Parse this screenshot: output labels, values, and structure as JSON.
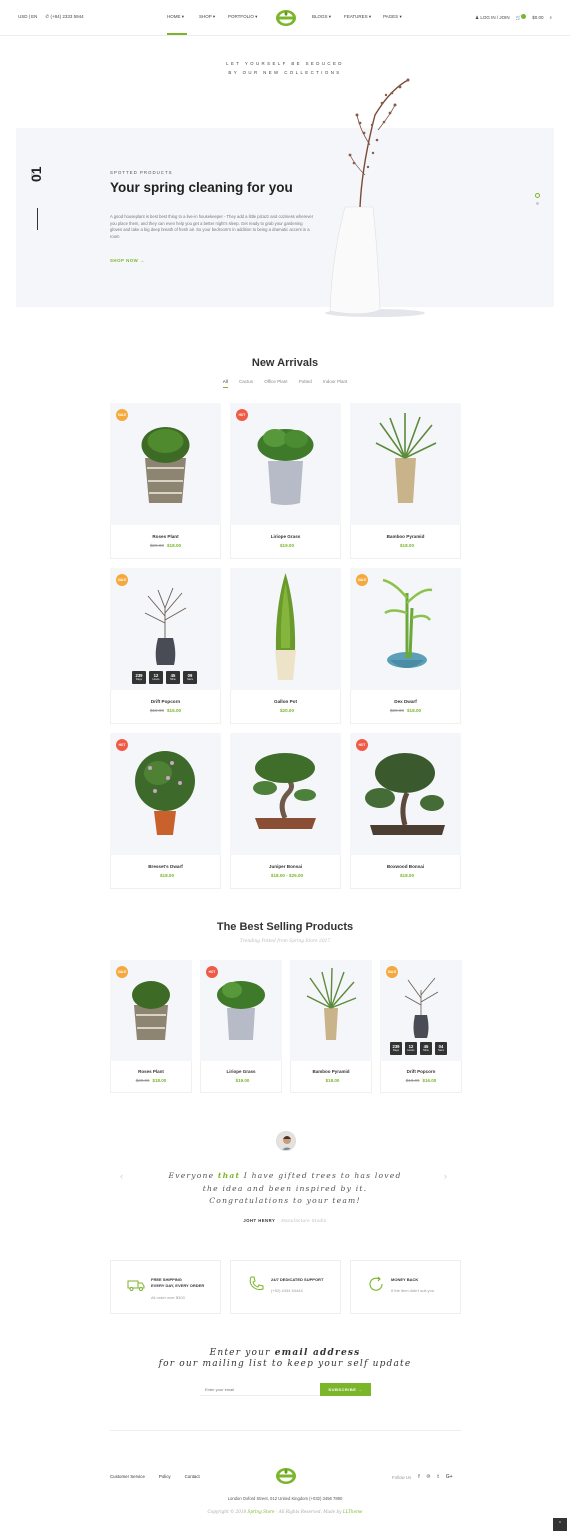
{
  "header": {
    "currency": "USD | EN",
    "phone": "(+84) 2333 5944",
    "nav": [
      "HOME",
      "SHOP",
      "PORTFOLIO",
      "BLOGS",
      "FEATURES",
      "PAGES"
    ],
    "login": "LOG IN / JOIN",
    "cart_total": "$0.00"
  },
  "hero": {
    "kicker_line1": "LET YOURSELF BE SEDUCED",
    "kicker_line2": "BY OUR NEW COLLECTIONS",
    "slide_number": "01",
    "slide_total": "/02",
    "tag": "SPOTTED PRODUCTS",
    "title": "Your spring cleaning for you",
    "description": "A good houseplant is best best thing to a live-in housekeeper - They add a little pizazz and coziness wherever you place them, and they can even help you get a better night's sleep. Get ready to grab your gardening gloves and take a big deep breath of fresh air. So your bedroom's in addition to being a dramatic accent in a room",
    "link": "SHOP NOW →"
  },
  "new_arrivals": {
    "title": "New Arrivals",
    "filters": [
      "All",
      "Cactus",
      "Office Plant",
      "Potted",
      "Indoor Plant"
    ],
    "products": [
      {
        "name": "Roses Plant",
        "old_price": "$20.00",
        "price": "$18.00",
        "badge": "SALE"
      },
      {
        "name": "Liriope Grass",
        "old_price": "",
        "price": "$19.00",
        "badge": "HOT"
      },
      {
        "name": "Bamboo Pyramid",
        "old_price": "",
        "price": "$18.00",
        "badge": ""
      },
      {
        "name": "Drift Popcorn",
        "old_price": "$18.00",
        "price": "$16.00",
        "badge": "SALE"
      },
      {
        "name": "Gallon Pot",
        "old_price": "",
        "price": "$20.00",
        "badge": ""
      },
      {
        "name": "Dex Dwarf",
        "old_price": "$20.00",
        "price": "$18.00",
        "badge": "SALE"
      },
      {
        "name": "Bresset's Dwarf",
        "old_price": "",
        "price": "$18.00",
        "badge": "HOT"
      },
      {
        "name": "Juniper Bonsai",
        "old_price": "",
        "price": "$18.00 - $25.00",
        "badge": ""
      },
      {
        "name": "Boxwood Bonsai",
        "old_price": "",
        "price": "$18.00",
        "badge": "HOT"
      }
    ],
    "countdown": [
      {
        "value": "239",
        "unit": "Days"
      },
      {
        "value": "12",
        "unit": "Hours"
      },
      {
        "value": "45",
        "unit": "Mins"
      },
      {
        "value": "09",
        "unit": "Secs"
      }
    ]
  },
  "best_selling": {
    "title": "The Best Selling Products",
    "subtitle": "Trending Potted from Spring Store 2017",
    "products": [
      {
        "name": "Roses Plant",
        "old_price": "$20.00",
        "price": "$18.00",
        "badge": "SALE"
      },
      {
        "name": "Liriope Grass",
        "old_price": "",
        "price": "$19.00",
        "badge": "HOT"
      },
      {
        "name": "Bamboo Pyramid",
        "old_price": "",
        "price": "$18.00",
        "badge": ""
      },
      {
        "name": "Drift Popcorn",
        "old_price": "$18.00",
        "price": "$16.00",
        "badge": "SALE"
      }
    ],
    "countdown": [
      {
        "value": "239",
        "unit": "Days"
      },
      {
        "value": "12",
        "unit": "Hours"
      },
      {
        "value": "45",
        "unit": "Mins"
      },
      {
        "value": "04",
        "unit": "Secs"
      }
    ]
  },
  "testimonial": {
    "quote_before": "Everyone ",
    "quote_highlight": "that",
    "quote_after": " I have gifted trees to has loved the idea and been inspired by it. Congratulations to your team!",
    "author": "JOHT HENRY",
    "role": "Manufacture Studio"
  },
  "features": [
    {
      "title_line1": "FREE SHIPPING",
      "title_line2": "EVERY DAY, EVERY ORDER",
      "sub": "All order over $300"
    },
    {
      "title_line1": "24/7 DEDICATED SUPPORT",
      "title_line2": "",
      "sub": "(+52) 4334 54444"
    },
    {
      "title_line1": "MONEY BACK",
      "title_line2": "",
      "sub": "If the item didn't suit you"
    }
  ],
  "newsletter": {
    "line1_a": "Enter your ",
    "line1_b": "email address",
    "line2": "for our mailing list to keep your self update",
    "placeholder": "Enter your email",
    "button": "SUBSCRIBE →"
  },
  "footer": {
    "links": [
      "Customer Service",
      "Policy",
      "Contact"
    ],
    "follow": "Follow Us",
    "socials": [
      "f",
      "℗",
      "t",
      "G+"
    ],
    "address": "London Oxford Street, 012 United Kingdom   (+032) 3456 7890",
    "copyright_a": "Copyright © 2018 ",
    "copyright_brand": "Spring Store",
    "copyright_b": " - All Rights Reserved. Made by ",
    "copyright_author": "LLTheme"
  },
  "colors": {
    "accent": "#7ab52a",
    "sale": "#f5a93c",
    "hot": "#ef5b47",
    "panel": "#f5f6f9"
  }
}
